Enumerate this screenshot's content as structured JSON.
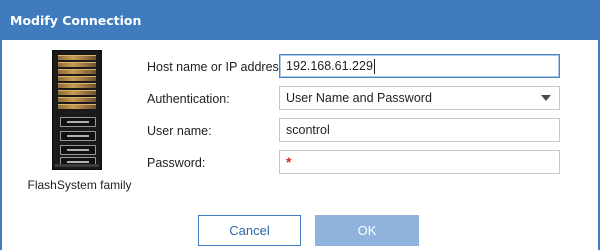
{
  "dialog": {
    "title": "Modify Connection"
  },
  "device": {
    "caption": "FlashSystem family"
  },
  "form": {
    "host": {
      "label": "Host name or IP address:",
      "value": "192.168.61.229"
    },
    "auth": {
      "label": "Authentication:",
      "value": "User Name and Password"
    },
    "user": {
      "label": "User name:",
      "value": "scontrol"
    },
    "password": {
      "label": "Password:",
      "value": "",
      "required_marker": "*"
    }
  },
  "buttons": {
    "cancel": "Cancel",
    "ok": "OK"
  },
  "icons": {
    "dropdown": "chevron-down-icon",
    "device": "storage-server-icon"
  },
  "colors": {
    "accent": "#3f7bbd",
    "ok_disabled": "#8fb3dd",
    "required": "#d62b2b"
  }
}
